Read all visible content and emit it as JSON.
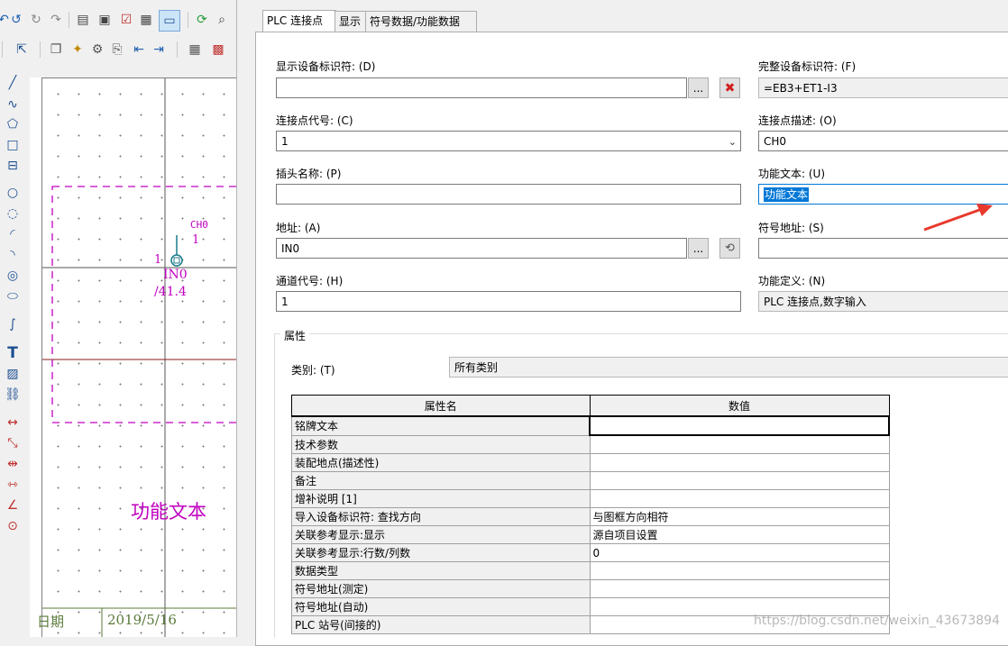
{
  "toolbar": {
    "row1_icons": [
      "undo-icon",
      "undo-arrow-icon",
      "redo-icon",
      "redo-arrow-icon",
      "window-icon",
      "properties-icon",
      "checklist-icon",
      "table-icon",
      "page-icon",
      "screen-icon",
      "refresh-icon",
      "search-icon"
    ],
    "row2_icons": [
      "layer-icon",
      "cursor-delete-icon",
      "copy-page-icon",
      "new-page-icon",
      "page-settings-icon",
      "export-page-icon",
      "import-page-icon",
      "forward-page-icon",
      "grid-icon",
      "color-grid-icon"
    ]
  },
  "drawing_tools": [
    "line-tool-icon",
    "polyline-tool-icon",
    "polygon-tool-icon",
    "rectangle-tool-icon",
    "structure-box-tool-icon",
    "circle-tool-icon",
    "circle-3point-tool-icon",
    "arc-tool-icon",
    "arc-center-tool-icon",
    "ellipse-rect-tool-icon",
    "ellipse-tool-icon",
    "spline-tool-icon",
    "text-tool-icon",
    "image-tool-icon",
    "hyperlink-tool-icon",
    "dimension-tool-icon",
    "dimension-aligned-tool-icon",
    "dimension-chain-tool-icon",
    "dimension-baseline-tool-icon",
    "dimension-angle-tool-icon",
    "dimension-radius-tool-icon"
  ],
  "canvas": {
    "ch_label": "CH0",
    "ch_number": "1",
    "pin_number": "1",
    "address": "IN0",
    "cross_ref": "/41.4",
    "function_text": "功能文本",
    "footer_date_label": "日期",
    "footer_date": "2019/5/16"
  },
  "tabs": [
    "PLC 连接点",
    "显示",
    "符号数据/功能数据"
  ],
  "form": {
    "display_dt_label": "显示设备标识符: (D)",
    "display_dt_value": "",
    "full_dt_label": "完整设备标识符: (F)",
    "full_dt_value": "=EB3+ET1-I3",
    "conn_code_label": "连接点代号: (C)",
    "conn_code_value": "1",
    "conn_desc_label": "连接点描述: (O)",
    "conn_desc_value": "CH0",
    "plug_name_label": "插头名称: (P)",
    "plug_name_value": "",
    "func_text_label": "功能文本: (U)",
    "func_text_value": "功能文本",
    "address_label": "地址: (A)",
    "address_value": "IN0",
    "symbol_addr_label": "符号地址: (S)",
    "symbol_addr_value": "",
    "channel_label": "通道代号: (H)",
    "channel_value": "1",
    "func_def_label": "功能定义: (N)",
    "func_def_value": "PLC 连接点,数字输入",
    "ellipsis": "..."
  },
  "properties": {
    "group_title": "属性",
    "category_label": "类别: (T)",
    "category_value": "所有类别",
    "col_name": "属性名",
    "col_value": "数值",
    "rows": [
      {
        "name": "铭牌文本",
        "value": ""
      },
      {
        "name": "技术参数",
        "value": ""
      },
      {
        "name": "装配地点(描述性)",
        "value": ""
      },
      {
        "name": "备注",
        "value": ""
      },
      {
        "name": "增补说明 [1]",
        "value": ""
      },
      {
        "name": "导入设备标识符: 查找方向",
        "value": "与图框方向相符"
      },
      {
        "name": "关联参考显示:显示",
        "value": "源自项目设置"
      },
      {
        "name": "关联参考显示:行数/列数",
        "value": "0"
      },
      {
        "name": "数据类型",
        "value": ""
      },
      {
        "name": "符号地址(测定)",
        "value": ""
      },
      {
        "name": "符号地址(自动)",
        "value": ""
      },
      {
        "name": "PLC 站号(间接的)",
        "value": ""
      }
    ]
  },
  "watermark": "https://blog.csdn.net/weixin_43673894",
  "colors": {
    "accent": "#0078d7",
    "drawing_magenta": "#c000c0",
    "arrow_red": "#e8392c",
    "footer_green": "#5a7a3a"
  }
}
